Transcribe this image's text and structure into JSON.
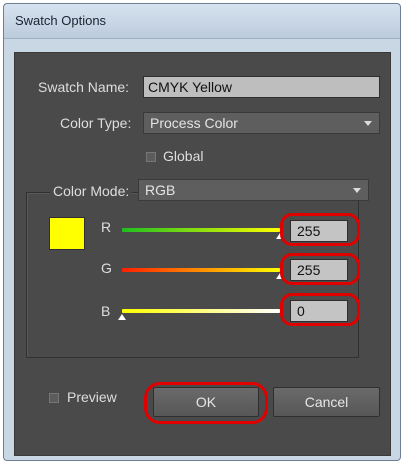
{
  "window": {
    "title": "Swatch Options"
  },
  "swatch_name": {
    "label": "Swatch Name:",
    "value": "CMYK Yellow"
  },
  "color_type": {
    "label": "Color Type:",
    "value": "Process Color"
  },
  "global_option": {
    "label": "Global",
    "checked": false
  },
  "color_mode": {
    "label": "Color Mode:",
    "value": "RGB"
  },
  "swatch_preview": {
    "color": "#ffff00"
  },
  "channels": [
    {
      "label": "R",
      "value": "255",
      "level": 1.0,
      "gradient": [
        "#1fbf1f",
        "#ffff00"
      ]
    },
    {
      "label": "G",
      "value": "255",
      "level": 1.0,
      "gradient": [
        "#ff1f00",
        "#ffff00"
      ]
    },
    {
      "label": "B",
      "value": "0",
      "level": 0.0,
      "gradient": [
        "#ffff00",
        "#ffffff"
      ]
    }
  ],
  "preview_option": {
    "label": "Preview",
    "checked": false
  },
  "buttons": {
    "ok": "OK",
    "cancel": "Cancel"
  },
  "highlight_color": "#e00000"
}
